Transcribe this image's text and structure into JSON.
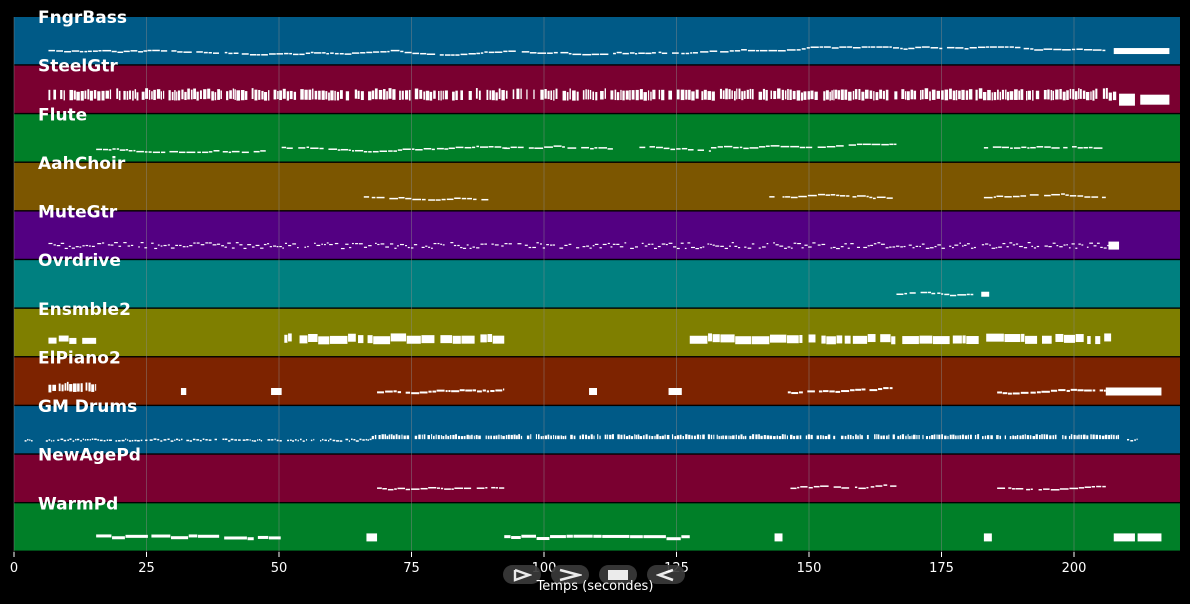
{
  "axis": {
    "xlabel": "Temps (secondes)",
    "xmin": 0,
    "xmax": 220,
    "ticks": [
      0,
      25,
      50,
      75,
      100,
      125,
      150,
      175,
      200
    ]
  },
  "colors": {
    "background": "#000000",
    "gridline": "#8a8a8a",
    "notes": "#ffffff",
    "track_label": "#ffffff"
  },
  "transport": [
    {
      "name": "play-icon"
    },
    {
      "name": "fast-forward-icon"
    },
    {
      "name": "stop-icon"
    },
    {
      "name": "rewind-icon"
    }
  ],
  "tracks": [
    {
      "name": "FngrBass",
      "color": "#005a87",
      "segments": [
        [
          6.5,
          206,
          "mel",
          1.5
        ],
        [
          207.5,
          218,
          "block",
          2
        ]
      ]
    },
    {
      "name": "SteelGtr",
      "color": "#7a0030",
      "segments": [
        [
          6.5,
          208,
          "chord",
          4
        ],
        [
          208.5,
          211.5,
          "block",
          5
        ],
        [
          212.5,
          218,
          "block",
          4
        ]
      ]
    },
    {
      "name": "Flute",
      "color": "#007f28",
      "segments": [
        [
          15.5,
          47.5,
          "mel",
          1.5
        ],
        [
          50.5,
          93,
          "mel",
          1.5
        ],
        [
          92.5,
          113,
          "mel",
          1.5
        ],
        [
          118,
          131.5,
          "mel",
          1.5
        ],
        [
          131.5,
          166.5,
          "mel",
          1.5
        ],
        [
          183,
          206,
          "mel",
          1.5
        ]
      ]
    },
    {
      "name": "AahChoir",
      "color": "#7c5600",
      "segments": [
        [
          66,
          67,
          "mel",
          1.5
        ],
        [
          67.5,
          89.5,
          "mel",
          1.5
        ],
        [
          142.5,
          143.5,
          "mel",
          1.5
        ],
        [
          145,
          166.5,
          "mel",
          1.5
        ],
        [
          183,
          206,
          "mel",
          1.5
        ]
      ]
    },
    {
      "name": "MuteGtr",
      "color": "#530082",
      "segments": [
        [
          6.5,
          206.5,
          "zig",
          1.2
        ],
        [
          206.5,
          208.5,
          "block",
          3
        ]
      ]
    },
    {
      "name": "Ovrdrive",
      "color": "#008080",
      "segments": [
        [
          166.5,
          181,
          "mel",
          1.5
        ],
        [
          182.5,
          184,
          "block",
          1.5
        ]
      ]
    },
    {
      "name": "Ensmble2",
      "color": "#7f7f00",
      "segments": [
        [
          6.5,
          15.5,
          "blocks",
          3
        ],
        [
          51,
          92.5,
          "blocks",
          4
        ],
        [
          127.5,
          207,
          "blocks",
          4
        ]
      ]
    },
    {
      "name": "ElPiano2",
      "color": "#7d2300",
      "segments": [
        [
          6.5,
          15.5,
          "chord",
          3
        ],
        [
          31.5,
          32.5,
          "block",
          2.5
        ],
        [
          48.5,
          50.5,
          "block",
          2.5
        ],
        [
          68.5,
          92.5,
          "mel",
          2
        ],
        [
          108.5,
          110,
          "block",
          2.5
        ],
        [
          123.5,
          126,
          "block",
          2.5
        ],
        [
          146,
          166.5,
          "mel",
          2
        ],
        [
          185.5,
          206,
          "mel",
          2
        ],
        [
          206,
          216.5,
          "block",
          3
        ]
      ]
    },
    {
      "name": "GM Drums",
      "color": "#005a87",
      "segments": [
        [
          2,
          3.5,
          "drum",
          1.5
        ],
        [
          6,
          67.5,
          "drum",
          1.5
        ],
        [
          67.5,
          185.5,
          "drumh",
          3
        ],
        [
          185.5,
          208.5,
          "drumh",
          3
        ],
        [
          210,
          212,
          "drum",
          1.5
        ]
      ]
    },
    {
      "name": "NewAgePd",
      "color": "#7a0030",
      "segments": [
        [
          68.5,
          92.5,
          "mel",
          1.5
        ],
        [
          146.5,
          166.5,
          "mel",
          1.5
        ],
        [
          185.5,
          206,
          "mel",
          1.5
        ]
      ]
    },
    {
      "name": "WarmPd",
      "color": "#007f28",
      "segments": [
        [
          15.5,
          50.5,
          "pad",
          3
        ],
        [
          66.5,
          68.5,
          "block",
          3
        ],
        [
          92.5,
          127.5,
          "pad",
          3
        ],
        [
          143.5,
          145,
          "block",
          3
        ],
        [
          183,
          184.5,
          "block",
          3
        ],
        [
          207.5,
          211.5,
          "block",
          3
        ],
        [
          212,
          216.5,
          "block",
          3
        ]
      ]
    }
  ]
}
